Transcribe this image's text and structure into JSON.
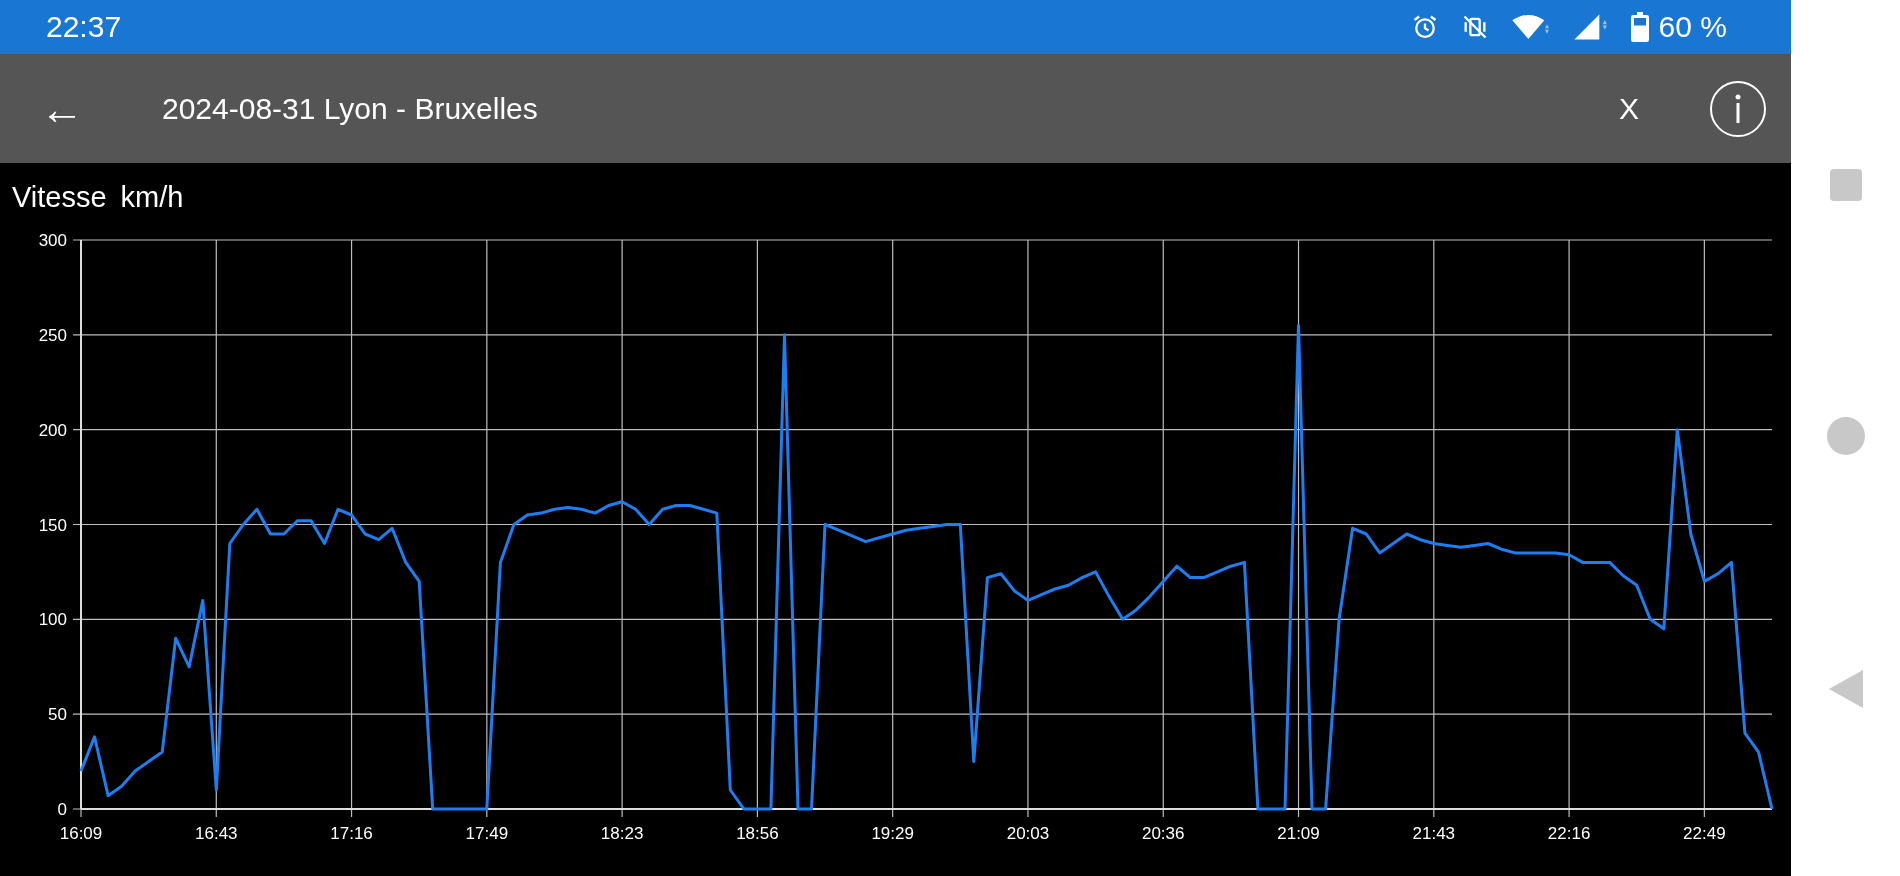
{
  "status_bar": {
    "time": "22:37",
    "battery": "60 %"
  },
  "app_bar": {
    "back": "←",
    "title": "2024-08-31 Lyon - Bruxelles",
    "close": "X"
  },
  "chart": {
    "chart_data": {
      "type": "line",
      "grid": true,
      "ylabel": "km/h",
      "ylim": [
        0,
        300
      ],
      "yticks": [
        0,
        50,
        100,
        150,
        200,
        250,
        300
      ],
      "categories": [
        "16:09",
        null,
        null,
        null,
        null,
        null,
        null,
        null,
        null,
        null,
        "16:43",
        null,
        null,
        null,
        null,
        null,
        null,
        null,
        null,
        null,
        "17:16",
        null,
        null,
        null,
        null,
        null,
        null,
        null,
        null,
        null,
        "17:49",
        null,
        null,
        null,
        null,
        null,
        null,
        null,
        null,
        null,
        "18:23",
        null,
        null,
        null,
        null,
        null,
        null,
        null,
        null,
        null,
        "18:56",
        null,
        null,
        null,
        null,
        null,
        null,
        null,
        null,
        null,
        "19:29",
        null,
        null,
        null,
        null,
        null,
        null,
        null,
        null,
        null,
        "20:03",
        null,
        null,
        null,
        null,
        null,
        null,
        null,
        null,
        null,
        "20:36",
        null,
        null,
        null,
        null,
        null,
        null,
        null,
        null,
        null,
        "21:09",
        null,
        null,
        null,
        null,
        null,
        null,
        null,
        null,
        null,
        "21:43",
        null,
        null,
        null,
        null,
        null,
        null,
        null,
        null,
        null,
        "22:16",
        null,
        null,
        null,
        null,
        null,
        null,
        null,
        null,
        null,
        "22:49",
        null,
        null,
        null,
        null,
        null
      ],
      "series": [
        {
          "name": "Vitesse",
          "color": "#1e7ef0",
          "values": [
            20,
            38,
            7,
            12,
            20,
            25,
            30,
            90,
            75,
            110,
            10,
            140,
            150,
            158,
            145,
            145,
            152,
            152,
            140,
            158,
            155,
            145,
            142,
            148,
            130,
            120,
            0,
            0,
            0,
            0,
            0,
            130,
            150,
            155,
            156,
            158,
            159,
            158,
            156,
            160,
            162,
            158,
            150,
            158,
            160,
            160,
            158,
            156,
            10,
            0,
            0,
            0,
            250,
            0,
            0,
            150,
            147,
            144,
            141,
            143,
            145,
            147,
            148,
            149,
            150,
            150,
            25,
            122,
            124,
            115,
            110,
            113,
            116,
            118,
            122,
            125,
            112,
            100,
            105,
            112,
            120,
            128,
            122,
            122,
            125,
            128,
            130,
            0,
            0,
            0,
            255,
            0,
            0,
            100,
            148,
            145,
            135,
            140,
            145,
            142,
            140,
            139,
            138,
            139,
            140,
            137,
            135,
            135,
            135,
            135,
            134,
            130,
            130,
            130,
            123,
            118,
            100,
            95,
            200,
            145,
            120,
            124,
            130,
            40,
            30,
            0
          ]
        }
      ]
    }
  }
}
